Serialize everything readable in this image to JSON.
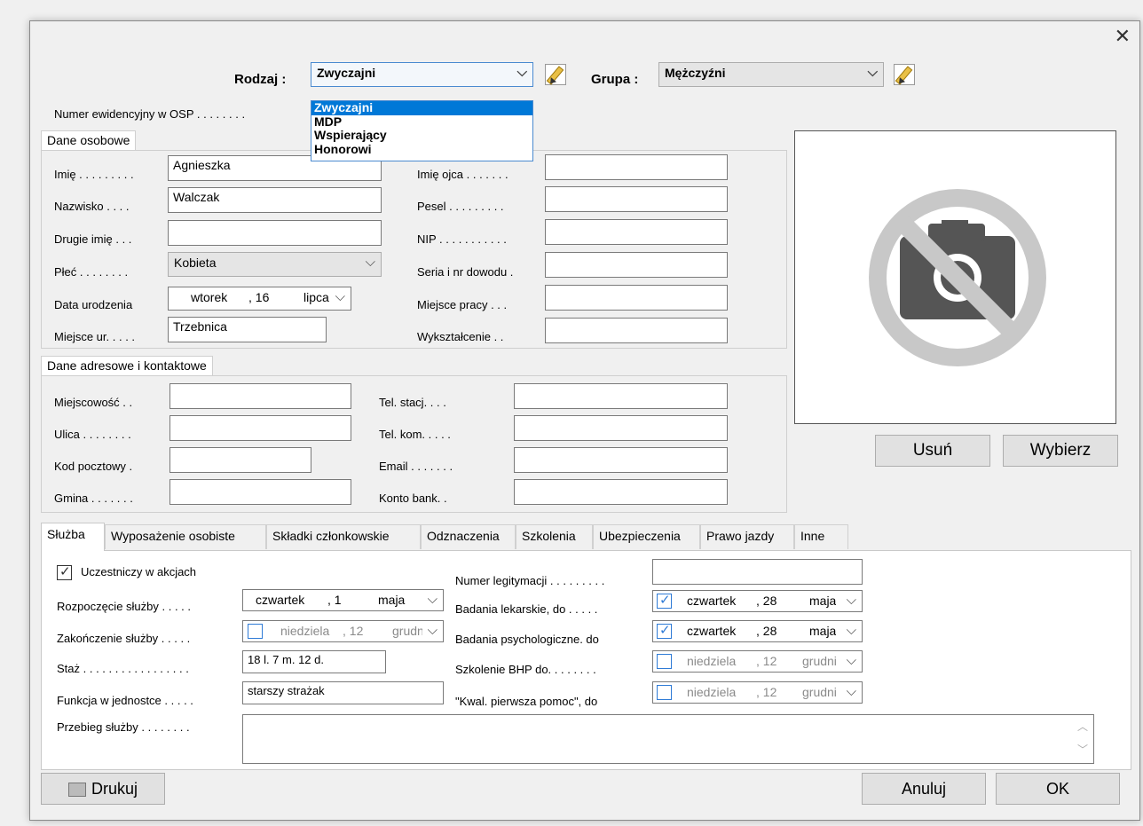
{
  "window": {
    "close_glyph": "✕"
  },
  "header": {
    "rodzaj_label": "Rodzaj :",
    "rodzaj_value": "Zwyczajni",
    "rodzaj_options": [
      "Zwyczajni",
      "MDP",
      "Wspierający",
      "Honorowi"
    ],
    "grupa_label": "Grupa :",
    "grupa_value": "Mężczyźni",
    "numer_label": "Numer ewidencyjny w OSP . . . . . . . ."
  },
  "personal": {
    "title": "Dane osobowe",
    "imie_label": "Imię . . . . . . . . .",
    "imie_value": "Agnieszka",
    "nazwisko_label": "Nazwisko . . . .",
    "nazwisko_value": "Walczak",
    "drugie_label": "Drugie imię . . .",
    "drugie_value": "",
    "plec_label": "Płeć . . . . . . . .",
    "plec_value": "Kobieta",
    "data_label": "Data urodzenia",
    "data_day": "wtorek",
    "data_num": ", 16",
    "data_month": "lipca",
    "miejsce_label": "Miejsce ur. . . . .",
    "miejsce_value": "Trzebnica",
    "imie_ojca_label": "Imię ojca . . . . . . .",
    "pesel_label": "Pesel . . . . . . . . .",
    "nip_label": "NIP . . . . . . . . . . .",
    "seria_label": "Seria i nr dowodu .",
    "miejsce_pracy_label": "Miejsce pracy . . .",
    "wyksztalcenie_label": "Wykształcenie . ."
  },
  "address": {
    "title": "Dane adresowe i kontaktowe",
    "miejscowosc_label": "Miejscowość . .",
    "ulica_label": "Ulica . . . . . . . .",
    "kod_label": "Kod pocztowy .",
    "gmina_label": "Gmina . . . . . . .",
    "tel_stacj_label": "Tel. stacj. . . .",
    "tel_kom_label": "Tel. kom. . . . .",
    "email_label": "Email . . . . . . .",
    "konto_label": "Konto bank. ."
  },
  "photo": {
    "remove_label": "Usuń",
    "choose_label": "Wybierz"
  },
  "tabs": [
    "Służba",
    "Wyposażenie osobiste",
    "Składki członkowskie",
    "Odznaczenia",
    "Szkolenia",
    "Ubezpieczenia",
    "Prawo jazdy",
    "Inne"
  ],
  "service": {
    "uczestniczy_label": "Uczestniczy w akcjach",
    "uczestniczy_checked": true,
    "rozpoczecie_label": "Rozpoczęcie służby . . . . .",
    "rozpoczecie_day": "czwartek",
    "rozpoczecie_num": ", 1",
    "rozpoczecie_month": "maja",
    "zakonczenie_label": "Zakończenie służby . . . . .",
    "zakonczenie_day": "niedziela",
    "zakonczenie_num": ", 12",
    "zakonczenie_month": "grudnia",
    "staz_label": "Staż . . . . . . . . . . . . . . . . .",
    "staz_value": "18 l. 7 m. 12 d.",
    "funkcja_label": "Funkcja w jednostce . . . . .",
    "funkcja_value": "starszy strażak",
    "przebieg_label": "Przebieg służby . . . . . . . .",
    "legitymacja_label": "Numer legitymacji . . . . . . . . .",
    "lekarskie_label": "Badania lekarskie, do . . . . .",
    "lekarskie_day": "czwartek",
    "lekarskie_num": ", 28",
    "lekarskie_month": "maja",
    "psych_label": "Badania psychologiczne. do",
    "psych_day": "czwartek",
    "psych_num": ", 28",
    "psych_month": "maja",
    "bhp_label": "Szkolenie BHP do. . . . . . . .",
    "bhp_day": "niedziela",
    "bhp_num": ", 12",
    "bhp_month": "grudnia",
    "pomoc_label": "\"Kwal. pierwsza pomoc\", do",
    "pomoc_day": "niedziela",
    "pomoc_num": ", 12",
    "pomoc_month": "grudnia"
  },
  "footer": {
    "print_label": "Drukuj",
    "cancel_label": "Anuluj",
    "ok_label": "OK"
  },
  "colors": {
    "accent": "#0078d7",
    "checkbox_blue": "#2f7bd6"
  }
}
